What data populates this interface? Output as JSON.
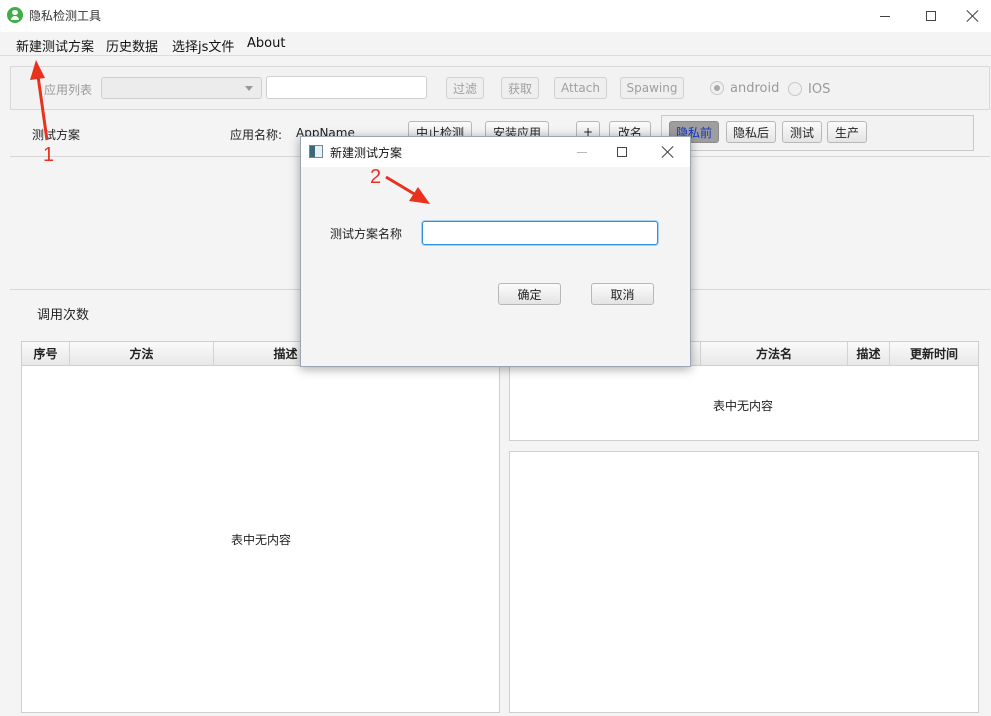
{
  "window": {
    "title": "隐私检测工具"
  },
  "menu": {
    "items": [
      "新建测试方案",
      "历史数据",
      "选择js文件",
      "About"
    ]
  },
  "toolbar": {
    "app_list_label": "应用列表",
    "filter": "过滤",
    "fetch": "获取",
    "attach": "Attach",
    "spawning": "Spawing",
    "android": "android",
    "ios": "IOS"
  },
  "scheme": {
    "label": "测试方案",
    "app_name_label": "应用名称:",
    "app_name": "AppName",
    "stop": "中止检测",
    "install": "安装应用",
    "add": "+",
    "rename": "改名",
    "envs": [
      "隐私前",
      "隐私后",
      "测试",
      "生产"
    ]
  },
  "call_count_label": "调用次数",
  "left_table": {
    "headers": [
      "序号",
      "方法",
      "描述"
    ],
    "empty_text": "表中无内容"
  },
  "right_table": {
    "headers": [
      "方法名",
      "描述",
      "更新时间"
    ],
    "empty_text": "表中无内容"
  },
  "dialog": {
    "title": "新建测试方案",
    "field_label": "测试方案名称",
    "field_value": "",
    "ok": "确定",
    "cancel": "取消"
  },
  "annotations": {
    "step1": "1",
    "step2": "2",
    "color": "#e8321e"
  }
}
